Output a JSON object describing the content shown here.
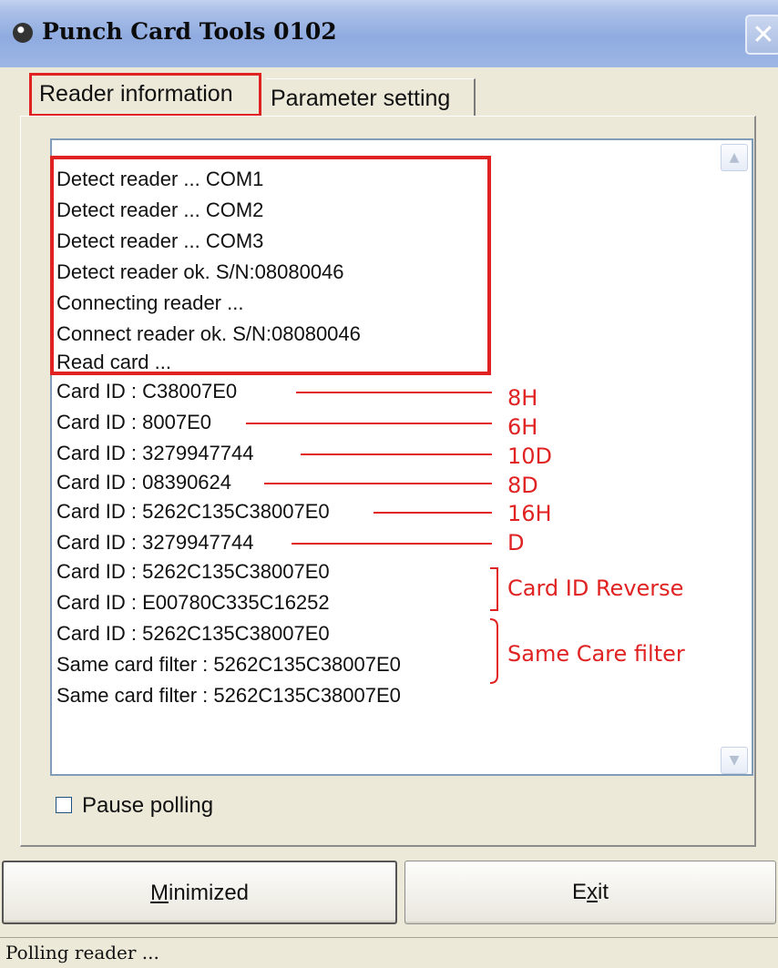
{
  "window": {
    "title": "Punch Card Tools 0102",
    "close_glyph": "✕"
  },
  "tabs": [
    {
      "label": "Reader information",
      "active": true
    },
    {
      "label": "Parameter setting",
      "active": false
    }
  ],
  "log": [
    "Detect reader ...  COM1",
    "Detect reader ...  COM2",
    "Detect reader ...  COM3",
    "Detect reader ok.  S/N:08080046",
    "Connecting reader ...",
    "Connect reader ok.  S/N:08080046",
    "Read card ...",
    "Card ID : C38007E0",
    "Card ID : 8007E0",
    "Card ID : 3279947744",
    "Card ID : 08390624",
    "Card ID : 5262C135C38007E0",
    "Card ID : 3279947744",
    "Card ID : 5262C135C38007E0",
    "Card ID : E00780C335C16252",
    "Card ID : 5262C135C38007E0",
    "Same card filter : 5262C135C38007E0",
    "Same card filter : 5262C135C38007E0"
  ],
  "annotations": {
    "format_labels": [
      "8H",
      "6H",
      "10D",
      "8D",
      "16H",
      "D"
    ],
    "reverse_label": "Card ID Reverse",
    "filter_label": "Same Care filter",
    "color": "#e02222"
  },
  "pause_polling": {
    "label": "Pause polling",
    "checked": false
  },
  "buttons": {
    "minimized": {
      "pre": "",
      "mn": "M",
      "post": "inimized"
    },
    "exit": {
      "pre": "E",
      "mn": "x",
      "post": "it"
    }
  },
  "status": "Polling reader ..."
}
